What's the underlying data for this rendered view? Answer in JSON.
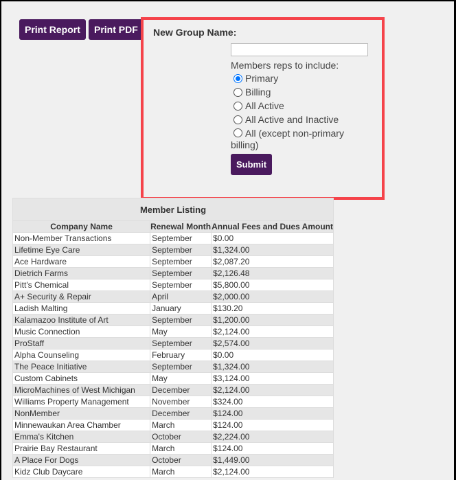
{
  "toolbar": {
    "print_report": "Print Report",
    "print_pdf": "Print PDF"
  },
  "form": {
    "group_name_label": "New Group Name:",
    "group_name_value": "",
    "reps_label": "Members reps to include:",
    "options": [
      "Primary",
      "Billing",
      "All Active",
      "All Active and Inactive",
      "All (except non-primary billing)"
    ],
    "selected": 0,
    "submit": "Submit"
  },
  "table": {
    "title": "Member Listing",
    "headers": [
      "Company Name",
      "Renewal Month",
      "Annual Fees and Dues Amount"
    ],
    "rows": [
      [
        "Non-Member Transactions",
        "September",
        "$0.00"
      ],
      [
        "Lifetime Eye Care",
        "September",
        "$1,324.00"
      ],
      [
        "Ace Hardware",
        "September",
        "$2,087.20"
      ],
      [
        "Dietrich Farms",
        "September",
        "$2,126.48"
      ],
      [
        "Pitt's Chemical",
        "September",
        "$5,800.00"
      ],
      [
        "A+ Security & Repair",
        "April",
        "$2,000.00"
      ],
      [
        "Ladish Malting",
        "January",
        "$130.20"
      ],
      [
        "Kalamazoo Institute of Art",
        "September",
        "$1,200.00"
      ],
      [
        "Music Connection",
        "May",
        "$2,124.00"
      ],
      [
        "ProStaff",
        "September",
        "$2,574.00"
      ],
      [
        "Alpha Counseling",
        "February",
        "$0.00"
      ],
      [
        "The Peace Initiative",
        "September",
        "$1,324.00"
      ],
      [
        "Custom Cabinets",
        "May",
        "$3,124.00"
      ],
      [
        "MicroMachines of West Michigan",
        "December",
        "$2,124.00"
      ],
      [
        "Williams Property Management",
        "November",
        "$324.00"
      ],
      [
        "NonMember",
        "December",
        "$124.00"
      ],
      [
        "Minnewaukan Area Chamber",
        "March",
        "$124.00"
      ],
      [
        "Emma's Kitchen",
        "October",
        "$2,224.00"
      ],
      [
        "Prairie Bay Restaurant",
        "March",
        "$124.00"
      ],
      [
        "A Place For Dogs",
        "October",
        "$1,449.00"
      ],
      [
        "Kidz Club Daycare",
        "March",
        "$2,124.00"
      ]
    ]
  }
}
